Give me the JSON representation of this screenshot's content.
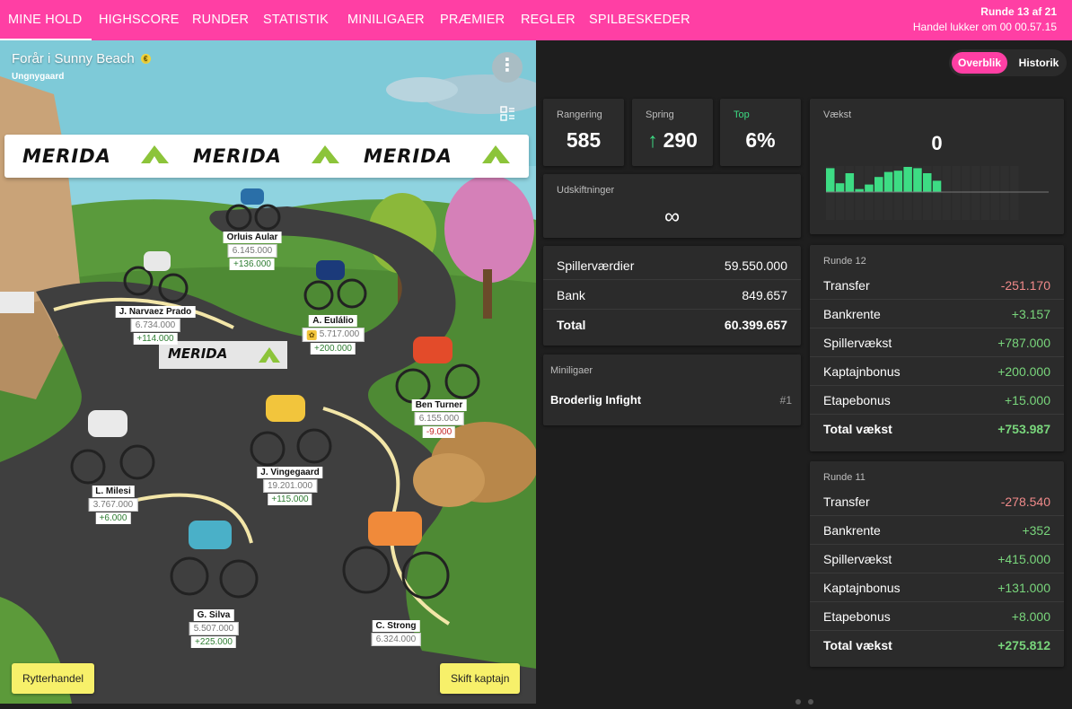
{
  "nav": {
    "items": [
      "MINE HOLD",
      "HIGHSCORE",
      "RUNDER",
      "STATISTIK",
      "MINILIGAER",
      "PRÆMIER",
      "REGLER",
      "SPILBESKEDER"
    ],
    "round_line": "Runde 13 af 21",
    "deadline_line": "Handel lukker om 00 00.57.15"
  },
  "team": {
    "name": "Forår i Sunny Beach",
    "badge": "€",
    "owner": "Ungnygaard",
    "menu_glyph": "⋮",
    "sponsor": "MERIDA",
    "riders": [
      {
        "name": "Orluis Aular",
        "value": "6.145.000",
        "delta": "+136.000",
        "delta_sign": "pos",
        "captain": false
      },
      {
        "name": "J. Narvaez Prado",
        "value": "6.734.000",
        "delta": "+114.000",
        "delta_sign": "pos",
        "captain": false
      },
      {
        "name": "A. Eulálio",
        "value": "5.717.000",
        "delta": "+200.000",
        "delta_sign": "pos",
        "captain": true
      },
      {
        "name": "Ben Turner",
        "value": "6.155.000",
        "delta": "-9.000",
        "delta_sign": "neg",
        "captain": false
      },
      {
        "name": "J. Vingegaard",
        "value": "19.201.000",
        "delta": "+115.000",
        "delta_sign": "pos",
        "captain": false
      },
      {
        "name": "L. Milesi",
        "value": "3.767.000",
        "delta": "+6.000",
        "delta_sign": "pos",
        "captain": false
      },
      {
        "name": "G. Silva",
        "value": "5.507.000",
        "delta": "+225.000",
        "delta_sign": "pos",
        "captain": false
      },
      {
        "name": "C. Strong",
        "value": "6.324.000",
        "delta": "",
        "delta_sign": "",
        "captain": false
      }
    ],
    "buttons": {
      "trade": "Rytterhandel",
      "captain": "Skift kaptajn"
    }
  },
  "overview": {
    "toggle": {
      "active": "Overblik",
      "inactive": "Historik"
    },
    "ranking": {
      "label": "Rangering",
      "value": "585"
    },
    "jump": {
      "label": "Spring",
      "value": "290",
      "arrow": "↑"
    },
    "top": {
      "label": "Top",
      "value": "6%"
    },
    "growth": {
      "label": "Vækst",
      "value": "0",
      "bars": [
        0.95,
        0.35,
        0.75,
        0.12,
        0.3,
        0.6,
        0.8,
        0.85,
        1.0,
        0.95,
        0.75,
        0.45
      ]
    },
    "substitutions": {
      "label": "Udskiftninger",
      "value": "∞"
    },
    "values": [
      {
        "k": "Spillerværdier",
        "v": "59.550.000"
      },
      {
        "k": "Bank",
        "v": "849.657"
      },
      {
        "k": "Total",
        "v": "60.399.657"
      }
    ],
    "minileagues": {
      "label": "Miniligaer",
      "name": "Broderlig Infight",
      "rank": "#1"
    },
    "round12": {
      "label": "Runde 12",
      "rows": [
        {
          "k": "Transfer",
          "v": "-251.170",
          "c": "r"
        },
        {
          "k": "Bankrente",
          "v": "+3.157",
          "c": "g"
        },
        {
          "k": "Spillervækst",
          "v": "+787.000",
          "c": "g"
        },
        {
          "k": "Kaptajnbonus",
          "v": "+200.000",
          "c": "g"
        },
        {
          "k": "Etapebonus",
          "v": "+15.000",
          "c": "g"
        },
        {
          "k": "Total vækst",
          "v": "+753.987",
          "c": "g"
        }
      ]
    },
    "round11": {
      "label": "Runde 11",
      "rows": [
        {
          "k": "Transfer",
          "v": "-278.540",
          "c": "r"
        },
        {
          "k": "Bankrente",
          "v": "+352",
          "c": "g"
        },
        {
          "k": "Spillervækst",
          "v": "+415.000",
          "c": "g"
        },
        {
          "k": "Kaptajnbonus",
          "v": "+131.000",
          "c": "g"
        },
        {
          "k": "Etapebonus",
          "v": "+8.000",
          "c": "g"
        },
        {
          "k": "Total vækst",
          "v": "+275.812",
          "c": "g"
        }
      ]
    }
  },
  "colors": {
    "accent": "#ff3fa4",
    "positive": "#79d67c",
    "negative": "#f08a8a",
    "bar": "#3ddc84"
  }
}
